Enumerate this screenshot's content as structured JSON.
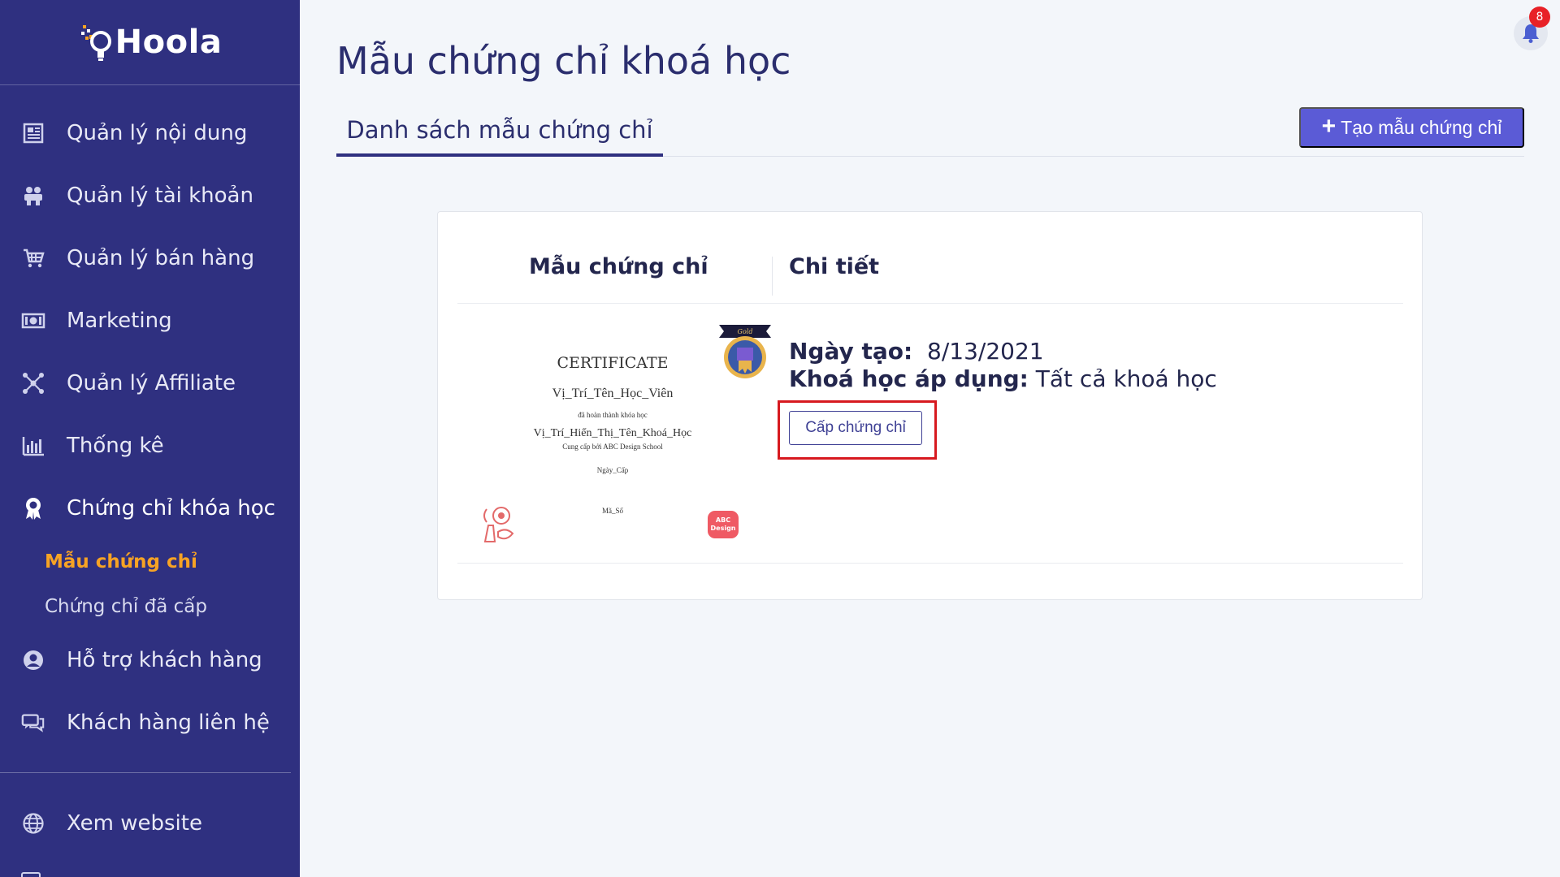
{
  "sidebar": {
    "logo_text": "Hoola",
    "items": [
      {
        "label": "Quản lý nội dung",
        "icon": "newspaper-icon"
      },
      {
        "label": "Quản lý tài khoản",
        "icon": "users-icon"
      },
      {
        "label": "Quản lý bán hàng",
        "icon": "cart-icon"
      },
      {
        "label": "Marketing",
        "icon": "money-icon"
      },
      {
        "label": "Quản lý Affiliate",
        "icon": "network-icon"
      },
      {
        "label": "Thống kê",
        "icon": "bar-chart-icon"
      },
      {
        "label": "Chứng chỉ khóa học",
        "icon": "award-icon",
        "active": true
      }
    ],
    "sub_items": [
      {
        "label": "Mẫu chứng chỉ",
        "active": true
      },
      {
        "label": "Chứng chỉ đã cấp"
      }
    ],
    "items_after": [
      {
        "label": "Hỗ trợ khách hàng",
        "icon": "user-circle-icon"
      },
      {
        "label": "Khách hàng liên hệ",
        "icon": "chat-icon"
      }
    ],
    "bottom_items": [
      {
        "label": "Xem website",
        "icon": "globe-icon"
      }
    ]
  },
  "header": {
    "title": "Mẫu chứng chỉ khoá học",
    "notification_count": "8"
  },
  "tabs": [
    {
      "label": "Danh sách mẫu chứng chỉ",
      "active": true
    }
  ],
  "create_button": {
    "plus": "+",
    "label": "Tạo mẫu chứng chỉ"
  },
  "table": {
    "columns": [
      "Mẫu chứng chỉ",
      "Chi tiết"
    ],
    "rows": [
      {
        "certificate_preview": {
          "title": "CERTIFICATE",
          "student": "Vị_Trí_Tên_Học_Viên",
          "completed_text": "đã hoàn thành khóa học",
          "course": "Vị_Trí_Hiển_Thị_Tên_Khoá_Học",
          "provided_by": "Cung cấp bởi ABC Design School",
          "date_placeholder": "Ngày_Cấp",
          "code_placeholder": "Mã_Số",
          "badge_text": "ABC Design",
          "seal_text": "Gold"
        },
        "created_label": "Ngày tạo:",
        "created_value": "8/13/2021",
        "course_label": "Khoá học áp dụng:",
        "course_value": "Tất cả khoá học",
        "action_label": "Cấp chứng chỉ"
      }
    ]
  },
  "colors": {
    "sidebar_bg": "#2f3080",
    "accent": "#5b5bd6",
    "active_sub": "#f7a324",
    "highlight": "#d7191f",
    "badge": "#e82127"
  }
}
